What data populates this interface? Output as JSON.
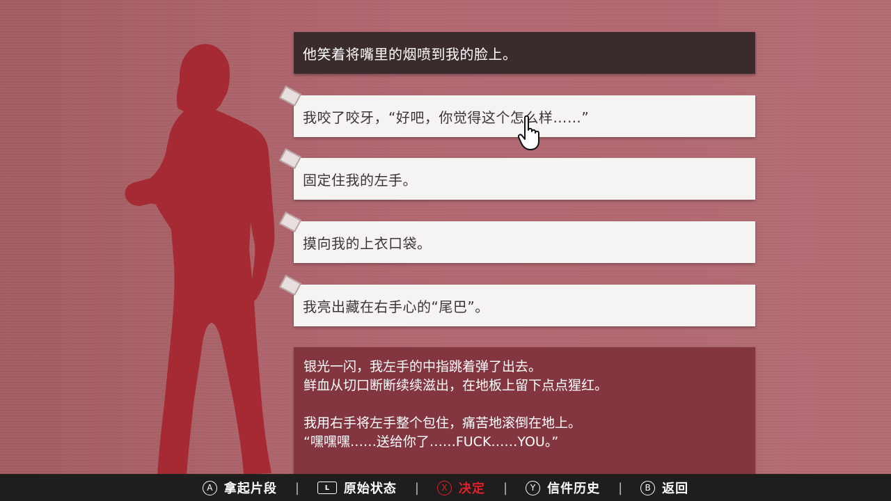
{
  "header": {
    "text": "他笑着将嘴里的烟喷到我的脸上。"
  },
  "choices": [
    {
      "text": "我咬了咬牙，“好吧，你觉得这个怎么样……”"
    },
    {
      "text": "固定住我的左手。"
    },
    {
      "text": "摸向我的上衣口袋。"
    },
    {
      "text": "我亮出藏在右手心的“尾巴”。"
    }
  ],
  "narration": {
    "lines": [
      "银光一闪，我左手的中指跳着弹了出去。",
      "鲜血从切口断断续续滋出，在地板上留下点点猩红。",
      "我用右手将左手整个包住，痛苦地滚倒在地上。",
      "“嘿嘿嘿……送给你了……FUCK……YOU。”"
    ]
  },
  "controls": [
    {
      "button": "A",
      "label": "拿起片段"
    },
    {
      "button": "L",
      "label": "原始状态"
    },
    {
      "button": "X",
      "label": "决定"
    },
    {
      "button": "Y",
      "label": "信件历史"
    },
    {
      "button": "B",
      "label": "返回"
    }
  ],
  "icons": {
    "cursor": "pointing-hand-cursor-icon",
    "choice_marker": "paper-tag-icon"
  },
  "colors": {
    "accent": "#e0202a",
    "narration_bg": "#833540",
    "header_bg": "#3a2c2d",
    "silhouette": "#a52a33"
  }
}
